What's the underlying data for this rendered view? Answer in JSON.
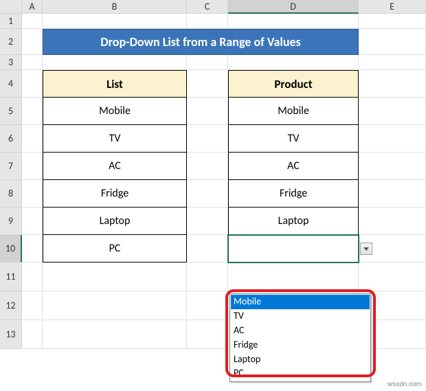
{
  "columns": [
    "A",
    "B",
    "C",
    "D",
    "E"
  ],
  "rows": [
    "1",
    "2",
    "3",
    "4",
    "5",
    "6",
    "7",
    "8",
    "9",
    "10",
    "11",
    "12",
    "13"
  ],
  "title": "Drop-Down List from a Range of Values",
  "list": {
    "header": "List",
    "items": [
      "Mobile",
      "TV",
      "AC",
      "Fridge",
      "Laptop",
      "PC"
    ]
  },
  "product": {
    "header": "Product",
    "items": [
      "Mobile",
      "TV",
      "AC",
      "Fridge",
      "Laptop",
      ""
    ]
  },
  "dropdown": {
    "options": [
      "Mobile",
      "TV",
      "AC",
      "Fridge",
      "Laptop",
      "PC"
    ],
    "highlighted": 0
  },
  "active_cell": "D10",
  "watermark": "wsxdn.com"
}
